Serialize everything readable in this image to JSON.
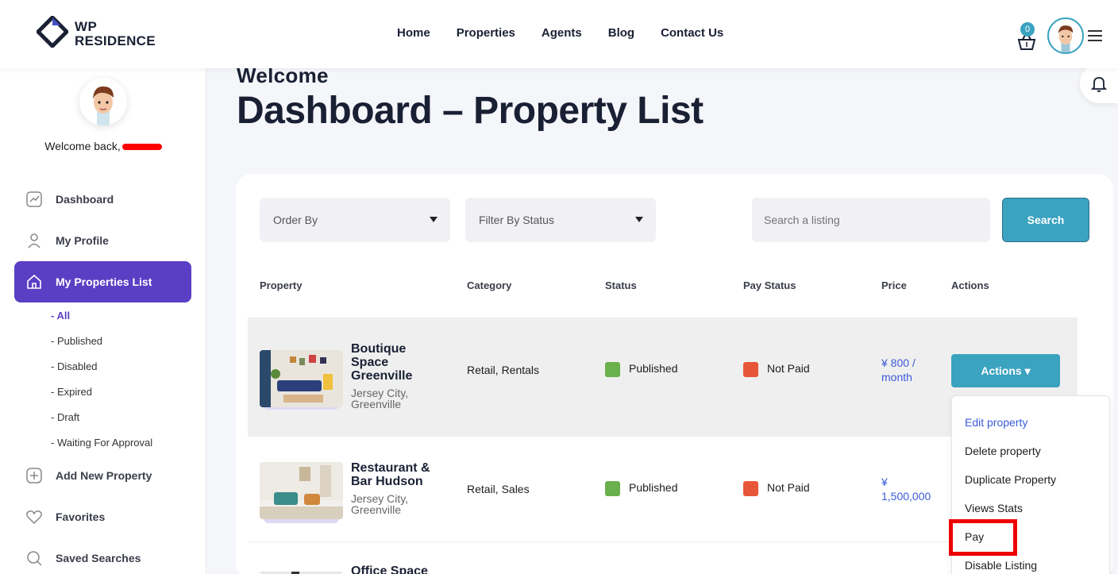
{
  "header": {
    "logo_top": "WP",
    "logo_bottom": "RESIDENCE",
    "nav": [
      "Home",
      "Properties",
      "Agents",
      "Blog",
      "Contact Us"
    ],
    "cart_count": "0"
  },
  "sidebar": {
    "welcome_text": "Welcome back,",
    "items": [
      {
        "label": "Dashboard",
        "icon": "chart-icon"
      },
      {
        "label": "My Profile",
        "icon": "user-icon"
      },
      {
        "label": "My Properties List",
        "icon": "home-icon"
      },
      {
        "label": "Add New Property",
        "icon": "plus-icon"
      },
      {
        "label": "Favorites",
        "icon": "heart-icon"
      },
      {
        "label": "Saved Searches",
        "icon": "search-icon"
      }
    ],
    "subitems": [
      "- All",
      "- Published",
      "- Disabled",
      "- Expired",
      "- Draft",
      "- Waiting For Approval"
    ]
  },
  "main": {
    "welcome": "Welcome",
    "title": "Dashboard – Property List",
    "order_by": "Order By",
    "filter_status": "Filter By Status",
    "search_placeholder": "Search a listing",
    "search_button": "Search",
    "columns": [
      "Property",
      "Category",
      "Status",
      "Pay Status",
      "Price",
      "Actions"
    ],
    "rows": [
      {
        "title_lines": [
          "Boutique",
          "Space",
          "Greenville"
        ],
        "location_lines": [
          "Jersey City,",
          "Greenville"
        ],
        "category": "Retail, Rentals",
        "status": "Published",
        "pay_status": "Not Paid",
        "price_lines": [
          "¥ 800 /",
          "month"
        ]
      },
      {
        "title_lines": [
          "Restaurant &",
          "Bar Hudson"
        ],
        "location_lines": [
          "Jersey City,",
          "Greenville"
        ],
        "category": "Retail, Sales",
        "status": "Published",
        "pay_status": "Not Paid",
        "price_lines": [
          "¥",
          "1,500,000"
        ]
      },
      {
        "title_lines": [
          "Office Space"
        ]
      }
    ],
    "actions_button": "Actions ▾",
    "dropdown": [
      "Edit property",
      "Delete property",
      "Duplicate Property",
      "Views Stats",
      "Pay",
      "Disable Listing"
    ]
  },
  "colors": {
    "accent": "#5a3fc4",
    "teal": "#3aa3c0",
    "published": "#6ab04c",
    "not_paid": "#e8563a",
    "highlight_box": "#ee0000"
  }
}
